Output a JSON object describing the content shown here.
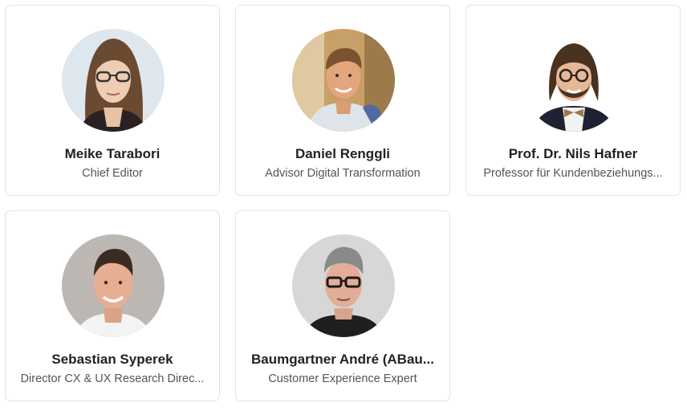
{
  "people": [
    {
      "name": "Meike Tarabori",
      "role": "Chief Editor"
    },
    {
      "name": "Daniel Renggli",
      "role": "Advisor Digital Transformation"
    },
    {
      "name": "Prof. Dr. Nils Hafner",
      "role": "Professor für Kundenbeziehungs..."
    },
    {
      "name": "Sebastian Syperek",
      "role": "Director CX & UX Research Direc..."
    },
    {
      "name": "Baumgartner André (ABau...",
      "role": "Customer Experience Expert"
    }
  ]
}
